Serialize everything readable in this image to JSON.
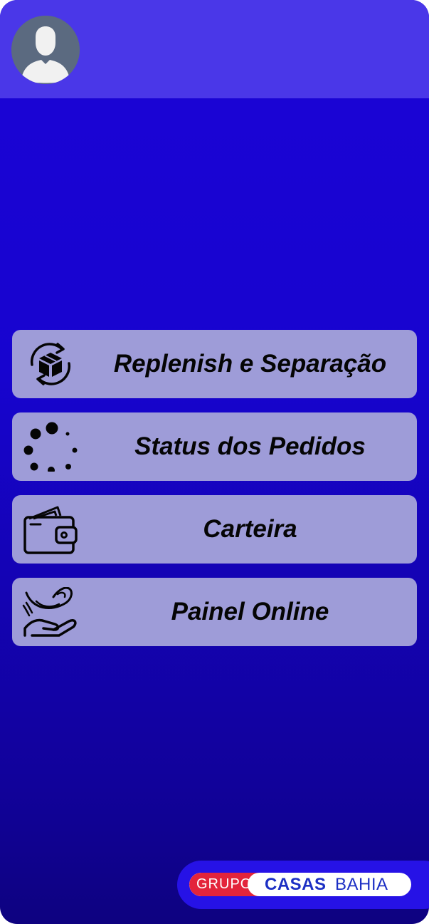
{
  "header": {
    "avatar_icon": "user-avatar-icon"
  },
  "menu": {
    "items": [
      {
        "label": "Replenish e Separação",
        "icon": "box-refresh-icon"
      },
      {
        "label": "Status dos Pedidos",
        "icon": "loading-dots-icon"
      },
      {
        "label": "Carteira",
        "icon": "wallet-icon"
      },
      {
        "label": "Painel Online",
        "icon": "hand-coin-icon"
      }
    ]
  },
  "logo": {
    "grupo": "GRUPO",
    "casas": "CASAS",
    "bahia": "BAHIA"
  },
  "colors": {
    "header": "#4a37e8",
    "background": "#1b04d6",
    "menu_item": "#9e9cd8",
    "logo_red": "#e3243b",
    "logo_blue": "#1c2fc4"
  }
}
